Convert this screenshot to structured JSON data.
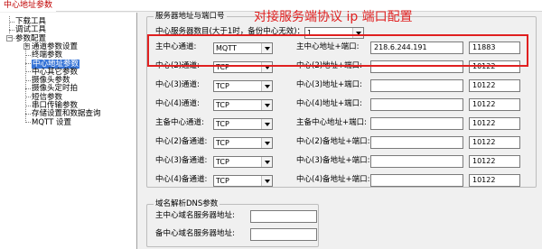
{
  "window": {
    "tab_label": "中心地址参数"
  },
  "tree": {
    "items": [
      {
        "label": "下载工具",
        "level": 1
      },
      {
        "label": "调试工具",
        "level": 1
      },
      {
        "label": "参数配置",
        "level": 1,
        "expanded": true
      },
      {
        "label": "通道参数设置",
        "level": 2,
        "collapsed": true
      },
      {
        "label": "终端参数",
        "level": 2
      },
      {
        "label": "中心地址参数",
        "level": 2,
        "selected": true
      },
      {
        "label": "中心其它参数",
        "level": 2
      },
      {
        "label": "摄像头参数",
        "level": 2
      },
      {
        "label": "摄像头定时拍",
        "level": 2
      },
      {
        "label": "短信参数",
        "level": 2
      },
      {
        "label": "串口传输参数",
        "level": 2
      },
      {
        "label": "存储设置和数据查询",
        "level": 2
      },
      {
        "label": "MQTT 设置",
        "level": 2
      }
    ]
  },
  "server_group": {
    "title": "服务器地址与端口号",
    "count_label": "中心服务器数目(大于1时，备份中心无效)：",
    "count_value": "1",
    "rows": [
      {
        "label": "主中心通道:",
        "protocol": "MQTT",
        "addr_label": "主中心地址+端口:",
        "ip": "218.6.244.191",
        "port": "11883"
      },
      {
        "label": "中心(2)通道:",
        "protocol": "TCP",
        "addr_label": "中心(2)地址+端口:",
        "ip": "",
        "port": "10122"
      },
      {
        "label": "中心(3)通道:",
        "protocol": "TCP",
        "addr_label": "中心(3)地址+端口:",
        "ip": "",
        "port": "10122"
      },
      {
        "label": "中心(4)通道:",
        "protocol": "TCP",
        "addr_label": "中心(4)地址+端口:",
        "ip": "",
        "port": "10122"
      },
      {
        "label": "主备中心通道:",
        "protocol": "TCP",
        "addr_label": "主备中心地址+端口:",
        "ip": "",
        "port": "10122"
      },
      {
        "label": "中心(2)备通道:",
        "protocol": "TCP",
        "addr_label": "中心(2)备地址+端口:",
        "ip": "",
        "port": "10122"
      },
      {
        "label": "中心(3)备通道:",
        "protocol": "TCP",
        "addr_label": "中心(3)备地址+端口:",
        "ip": "",
        "port": "10122"
      },
      {
        "label": "中心(4)备通道:",
        "protocol": "TCP",
        "addr_label": "中心(4)备地址+端口:",
        "ip": "",
        "port": "10122"
      }
    ]
  },
  "dns_group": {
    "title": "域名解析DNS参数",
    "main_label": "主中心域名服务器地址:",
    "main_value": "",
    "backup_label": "备中心域名服务器地址:",
    "backup_value": ""
  },
  "annotation": {
    "text": "对接服务端协议 ip 端口配置",
    "color": "#e02020"
  }
}
